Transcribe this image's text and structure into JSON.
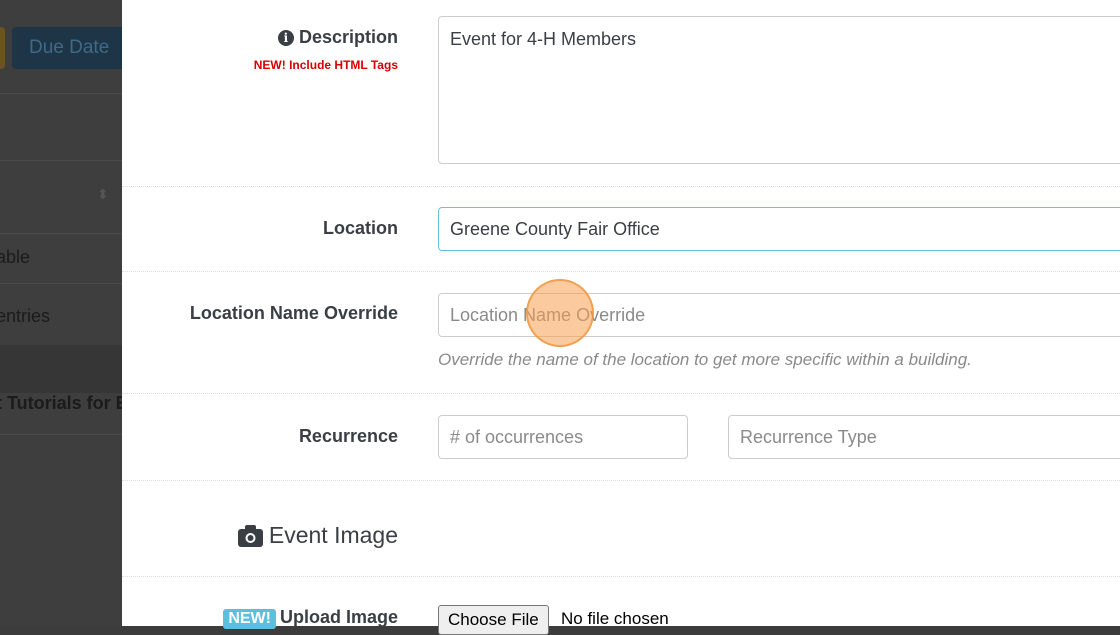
{
  "backdrop": {
    "due_date_button": "Due Date",
    "row1": "able",
    "row2": "entries",
    "row3": "t Tutorials for Ev"
  },
  "form": {
    "description": {
      "label": "Description",
      "note": "NEW! Include HTML Tags",
      "value": "Event for 4-H Members"
    },
    "location": {
      "label": "Location",
      "value": "Greene County Fair Office"
    },
    "location_override": {
      "label": "Location Name Override",
      "placeholder": "Location Name Override",
      "help": "Override the name of the location to get more specific within a building."
    },
    "recurrence": {
      "label": "Recurrence",
      "occurrences_placeholder": "# of occurrences",
      "type_placeholder": "Recurrence Type"
    },
    "event_image": {
      "heading": "Event Image"
    },
    "upload": {
      "badge": "NEW!",
      "label": "Upload Image",
      "button": "Choose File",
      "status": "No file chosen"
    }
  },
  "colors": {
    "accent": "#5bc0de",
    "required_note": "#d60000",
    "focus_border": "#66c3d3"
  }
}
